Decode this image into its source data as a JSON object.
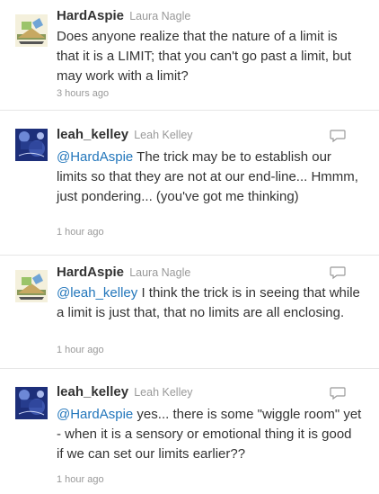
{
  "tweets": [
    {
      "screen_name": "HardAspie",
      "full_name": "Laura Nagle",
      "avatar_icon": "hardaspie-avatar",
      "mention": "",
      "text": "Does anyone realize that the nature of a limit is that it is a LIMIT; that you can't go past a limit, but may work with a limit?",
      "time": "3 hours ago"
    },
    {
      "screen_name": "leah_kelley",
      "full_name": "Leah Kelley",
      "avatar_icon": "leah-kelley-avatar",
      "mention": "@HardAspie",
      "text": " The trick may be to establish our limits so that they are not at our end-line... Hmmm, just pondering... (you've got me thinking)",
      "time": "1 hour ago"
    },
    {
      "screen_name": "HardAspie",
      "full_name": "Laura Nagle",
      "avatar_icon": "hardaspie-avatar",
      "mention": "@leah_kelley",
      "text": " I think the trick is in seeing that while a limit is just that, that no limits are all enclosing.",
      "time": "1 hour ago"
    },
    {
      "screen_name": "leah_kelley",
      "full_name": "Leah Kelley",
      "avatar_icon": "leah-kelley-avatar",
      "mention": "@HardAspie",
      "text": " yes... there is some \"wiggle room\" yet - when it is a sensory or emotional thing it is good if we can set our limits earlier??",
      "time": "1 hour ago"
    }
  ],
  "icons": {
    "reply": "speech-bubble-icon"
  }
}
